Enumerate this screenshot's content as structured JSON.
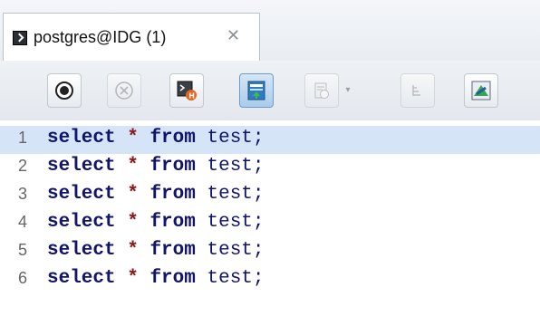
{
  "tab": {
    "title": "postgres@IDG (1)",
    "close_glyph": "✕",
    "icon": "terminal-icon"
  },
  "toolbar": {
    "buttons": [
      {
        "name": "execute-button",
        "icon": "record-icon",
        "enabled": true
      },
      {
        "name": "cancel-button",
        "icon": "cancel-circle-icon",
        "enabled": false
      },
      {
        "name": "explain-button",
        "icon": "explain-plan-icon",
        "enabled": true
      },
      {
        "name": "export-button",
        "icon": "export-results-icon",
        "enabled": true
      },
      {
        "name": "history-button",
        "icon": "history-icon",
        "enabled": false
      },
      {
        "name": "format-button",
        "icon": "format-sql-icon",
        "enabled": false
      },
      {
        "name": "visualize-button",
        "icon": "visualize-icon",
        "enabled": true
      }
    ]
  },
  "editor": {
    "current_line": 1,
    "lines": [
      {
        "num": "1",
        "kw": "select",
        "star": "*",
        "from": "from",
        "table": "test;"
      },
      {
        "num": "2",
        "kw": "select",
        "star": "*",
        "from": "from",
        "table": "test;"
      },
      {
        "num": "3",
        "kw": "select",
        "star": "*",
        "from": "from",
        "table": "test;"
      },
      {
        "num": "4",
        "kw": "select",
        "star": "*",
        "from": "from",
        "table": "test;"
      },
      {
        "num": "5",
        "kw": "select",
        "star": "*",
        "from": "from",
        "table": "test;"
      },
      {
        "num": "6",
        "kw": "select",
        "star": "*",
        "from": "from",
        "table": "test;"
      }
    ]
  },
  "colors": {
    "keyword": "#12146b",
    "star": "#8b1a1a",
    "current_line": "#d6e4f8"
  }
}
